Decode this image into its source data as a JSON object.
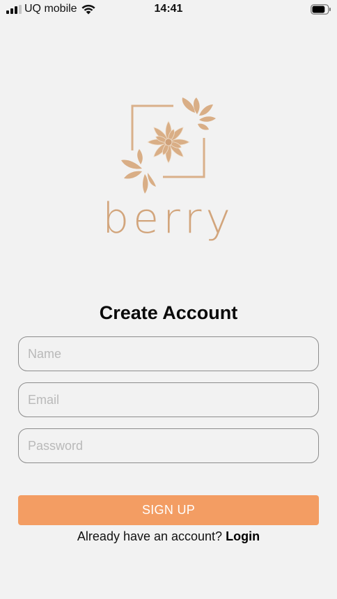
{
  "status_bar": {
    "carrier": "UQ mobile",
    "time": "14:41",
    "signal_bars": 3,
    "battery_level": 0.85
  },
  "logo": {
    "wordmark": "berry",
    "color": "#d2a57c"
  },
  "form": {
    "title": "Create Account",
    "name_placeholder": "Name",
    "email_placeholder": "Email",
    "password_placeholder": "Password",
    "name_value": "",
    "email_value": "",
    "password_value": "",
    "signup_label": "SIGN UP",
    "signup_color": "#f39d63"
  },
  "footer": {
    "prompt": "Already have an account?",
    "login_label": "Login"
  }
}
